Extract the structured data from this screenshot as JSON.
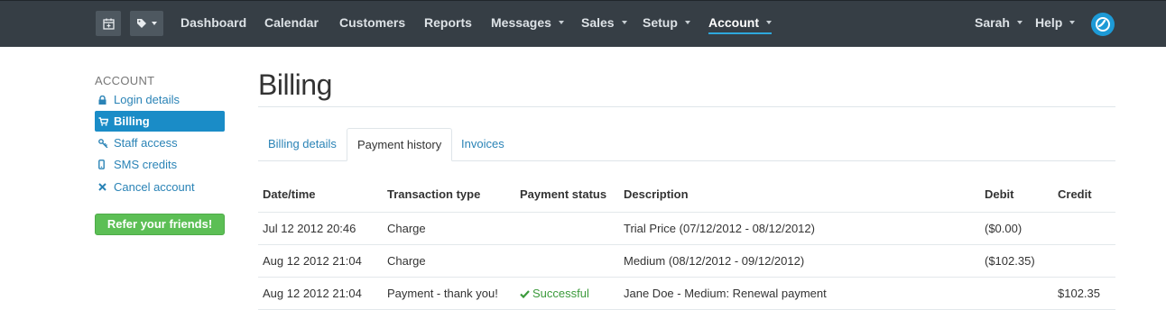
{
  "nav": {
    "items": [
      {
        "label": "Dashboard",
        "caret": false
      },
      {
        "label": "Calendar",
        "caret": false
      },
      {
        "label": "Customers",
        "caret": false
      },
      {
        "label": "Reports",
        "caret": false
      },
      {
        "label": "Messages",
        "caret": true
      },
      {
        "label": "Sales",
        "caret": true
      },
      {
        "label": "Setup",
        "caret": true
      },
      {
        "label": "Account",
        "caret": true,
        "active": true
      }
    ],
    "user": "Sarah",
    "help": "Help"
  },
  "sidebar": {
    "heading": "ACCOUNT",
    "items": [
      {
        "label": "Login details",
        "icon": "lock-icon"
      },
      {
        "label": "Billing",
        "icon": "cart-icon",
        "active": true
      },
      {
        "label": "Staff access",
        "icon": "key-icon"
      },
      {
        "label": "SMS credits",
        "icon": "mobile-icon"
      },
      {
        "label": "Cancel account",
        "icon": "close-icon"
      }
    ],
    "refer_label": "Refer your friends!"
  },
  "page": {
    "title": "Billing",
    "tabs": [
      {
        "label": "Billing details"
      },
      {
        "label": "Payment history",
        "active": true
      },
      {
        "label": "Invoices"
      }
    ]
  },
  "table": {
    "headers": [
      "Date/time",
      "Transaction type",
      "Payment status",
      "Description",
      "Debit",
      "Credit"
    ],
    "rows": [
      {
        "date": "Jul 12 2012 20:46",
        "type": "Charge",
        "status": "",
        "description": "Trial Price (07/12/2012 - 08/12/2012)",
        "debit": "($0.00)",
        "credit": ""
      },
      {
        "date": "Aug 12 2012 21:04",
        "type": "Charge",
        "status": "",
        "description": "Medium (08/12/2012 - 09/12/2012)",
        "debit": "($102.35)",
        "credit": ""
      },
      {
        "date": "Aug 12 2012 21:04",
        "type": "Payment - thank you!",
        "status": "Successful",
        "description": "Jane Doe - Medium: Renewal payment",
        "debit": "",
        "credit": "$102.35"
      }
    ]
  },
  "colors": {
    "topbar": "#363e45",
    "accent": "#1a8cc7",
    "link": "#2a83b6",
    "success": "#3b9a3b",
    "refer": "#5cbf55"
  }
}
